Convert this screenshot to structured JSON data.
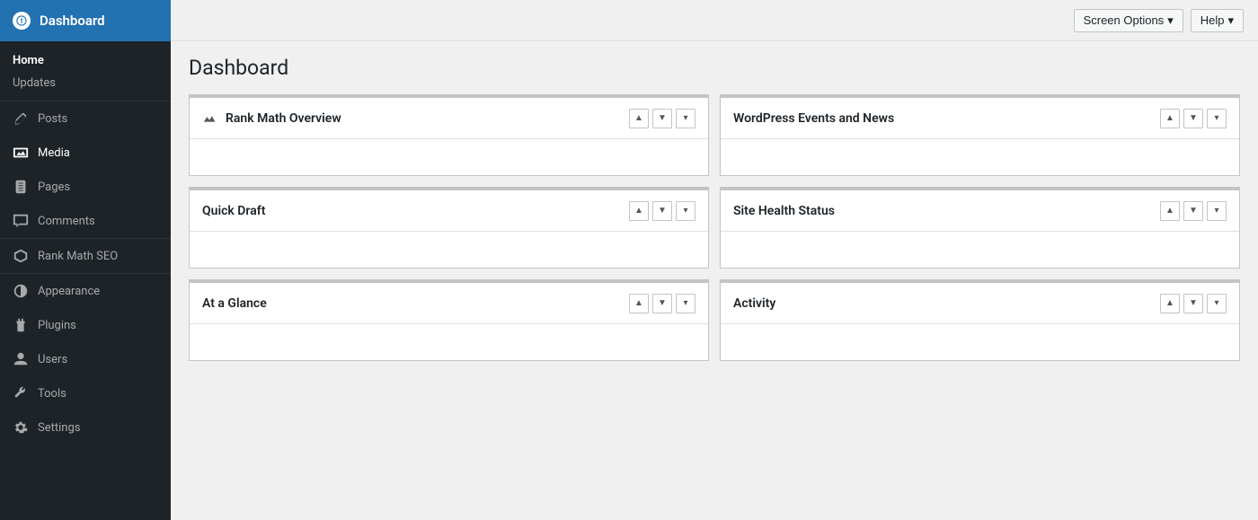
{
  "sidebar": {
    "logo": {
      "label": "Dashboard"
    },
    "home": {
      "label": "Home",
      "updates": "Updates"
    },
    "items": [
      {
        "id": "posts",
        "label": "Posts",
        "icon": "edit"
      },
      {
        "id": "media",
        "label": "Media",
        "icon": "media",
        "highlighted": true
      },
      {
        "id": "pages",
        "label": "Pages",
        "icon": "pages"
      },
      {
        "id": "comments",
        "label": "Comments",
        "icon": "comments"
      },
      {
        "id": "rank-math-seo",
        "label": "Rank Math SEO",
        "icon": "rank-math"
      },
      {
        "id": "appearance",
        "label": "Appearance",
        "icon": "appearance"
      },
      {
        "id": "plugins",
        "label": "Plugins",
        "icon": "plugins"
      },
      {
        "id": "users",
        "label": "Users",
        "icon": "users"
      },
      {
        "id": "tools",
        "label": "Tools",
        "icon": "tools"
      },
      {
        "id": "settings",
        "label": "Settings",
        "icon": "settings"
      }
    ]
  },
  "topbar": {
    "screen_options": "Screen Options",
    "help": "Help"
  },
  "main": {
    "title": "Dashboard",
    "widgets": [
      {
        "id": "rank-math-overview",
        "title": "Rank Math Overview",
        "has_icon": true,
        "col": 0
      },
      {
        "id": "wordpress-events-news",
        "title": "WordPress Events and News",
        "has_icon": false,
        "col": 1
      },
      {
        "id": "quick-draft",
        "title": "Quick Draft",
        "has_icon": false,
        "col": 0
      },
      {
        "id": "site-health-status",
        "title": "Site Health Status",
        "has_icon": false,
        "col": 1
      },
      {
        "id": "at-a-glance",
        "title": "At a Glance",
        "has_icon": false,
        "col": 0
      },
      {
        "id": "activity",
        "title": "Activity",
        "has_icon": false,
        "col": 1
      }
    ],
    "controls": {
      "up": "▲",
      "down": "▼",
      "toggle": "▾"
    }
  }
}
